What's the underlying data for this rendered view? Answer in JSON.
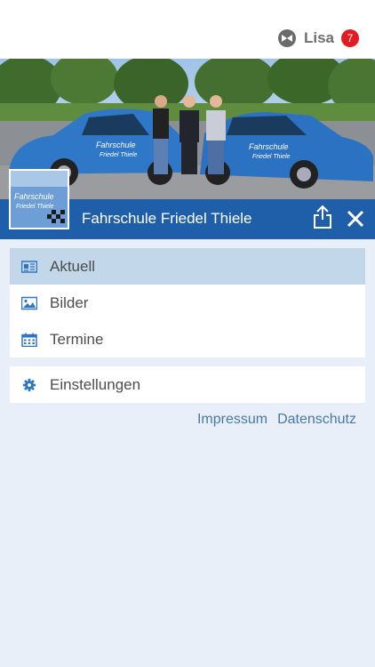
{
  "user": {
    "name": "Lisa",
    "notification_count": "7",
    "logo_icon": "app-logo-icon"
  },
  "header": {
    "title": "Fahrschule Friedel Thiele",
    "share_icon": "share-icon",
    "close_icon": "close-icon"
  },
  "thumbnail": {
    "logo_text_line1": "Fahrschule",
    "logo_text_line2": "Friedel Thiele"
  },
  "hero_car_text": {
    "line1": "Fahrschule",
    "line2": "Friedel Thiele"
  },
  "menu_main": [
    {
      "label": "Aktuell",
      "icon": "newspaper-icon",
      "active": true
    },
    {
      "label": "Bilder",
      "icon": "image-icon",
      "active": false
    },
    {
      "label": "Termine",
      "icon": "calendar-icon",
      "active": false
    }
  ],
  "menu_secondary": [
    {
      "label": "Einstellungen",
      "icon": "gear-icon"
    }
  ],
  "footer_links": {
    "impressum": "Impressum",
    "datenschutz": "Datenschutz"
  },
  "colors": {
    "primary": "#1f5ea8",
    "accent_icon": "#2f75c0",
    "active_row": "#c3d7ea",
    "badge": "#e21c23",
    "link": "#4a78a8",
    "background": "#e9eff8"
  }
}
